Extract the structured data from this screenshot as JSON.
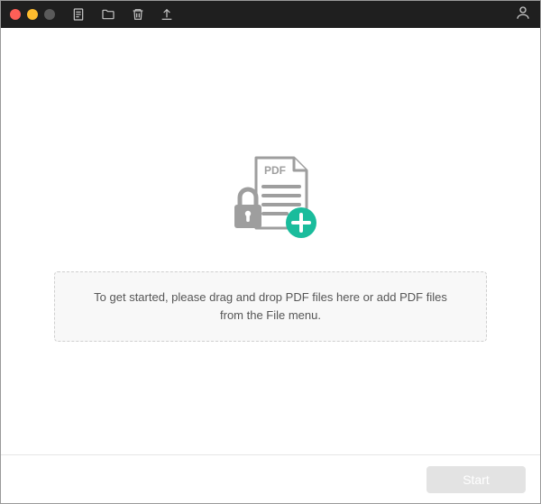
{
  "toolbar": {
    "icons": {
      "document": "document-icon",
      "folder": "folder-icon",
      "trash": "trash-icon",
      "upload": "upload-icon",
      "user": "user-icon"
    }
  },
  "illustration": {
    "pdf_label": "PDF"
  },
  "dropzone": {
    "text": "To get started, please drag and drop PDF files here or add PDF files from the File menu."
  },
  "footer": {
    "start_label": "Start",
    "start_enabled": false
  },
  "colors": {
    "accent": "#1abc9c",
    "titlebar": "#1f1f1f",
    "icon_stroke": "#c8c8c8",
    "illus_stroke": "#9e9e9e"
  }
}
